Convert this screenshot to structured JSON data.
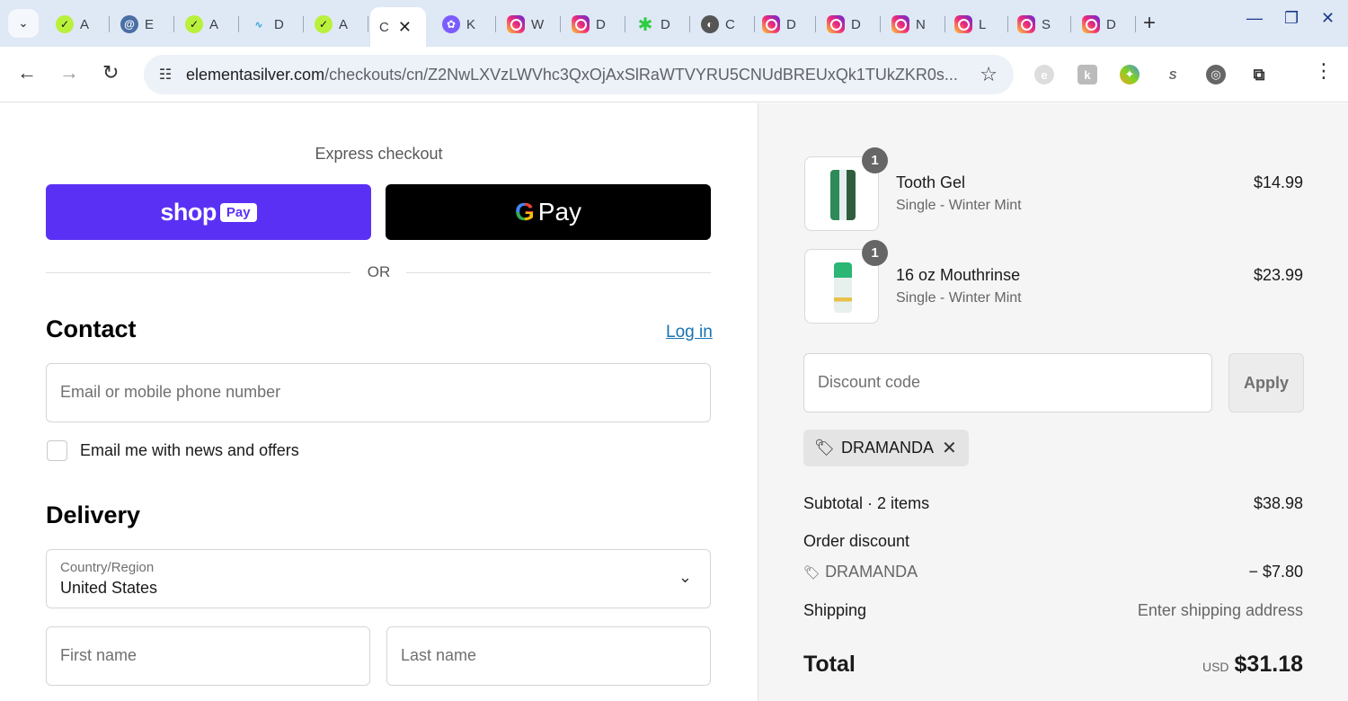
{
  "browser": {
    "tabs": [
      {
        "letter": "A",
        "fav": "green"
      },
      {
        "letter": "E",
        "fav": "spiral"
      },
      {
        "letter": "A",
        "fav": "green"
      },
      {
        "letter": "D",
        "fav": "wave"
      },
      {
        "letter": "A",
        "fav": "green"
      },
      {
        "letter": "C",
        "fav": "none",
        "active": true
      },
      {
        "letter": "K",
        "fav": "purple"
      },
      {
        "letter": "W",
        "fav": "insta"
      },
      {
        "letter": "D",
        "fav": "insta"
      },
      {
        "letter": "D",
        "fav": "lime"
      },
      {
        "letter": "C",
        "fav": "globe"
      },
      {
        "letter": "D",
        "fav": "insta"
      },
      {
        "letter": "D",
        "fav": "insta"
      },
      {
        "letter": "N",
        "fav": "insta"
      },
      {
        "letter": "L",
        "fav": "insta"
      },
      {
        "letter": "S",
        "fav": "insta"
      },
      {
        "letter": "D",
        "fav": "insta"
      }
    ],
    "url_host": "elementasilver.com",
    "url_path": "/checkouts/cn/Z2NwLXVzLWVhc3QxOjAxSlRaWTVYRU5CNUdBREUxQk1TUkZKR0s..."
  },
  "express": {
    "title": "Express checkout",
    "shop_word": "shop",
    "shop_pay": "Pay",
    "gpay_g": "G",
    "gpay_label": "Pay",
    "or": "OR"
  },
  "contact": {
    "heading": "Contact",
    "login": "Log in",
    "email_placeholder": "Email or mobile phone number",
    "news_label": "Email me with news and offers"
  },
  "delivery": {
    "heading": "Delivery",
    "country_label": "Country/Region",
    "country_value": "United States",
    "first_name": "First name",
    "last_name": "Last name"
  },
  "summary": {
    "items": [
      {
        "name": "Tooth Gel",
        "variant": "Single - Winter Mint",
        "price": "$14.99",
        "qty": "1"
      },
      {
        "name": "16 oz Mouthrinse",
        "variant": "Single - Winter Mint",
        "price": "$23.99",
        "qty": "1"
      }
    ],
    "discount_placeholder": "Discount code",
    "apply": "Apply",
    "applied_code": "DRAMANDA",
    "subtotal_label": "Subtotal · 2 items",
    "subtotal_value": "$38.98",
    "order_discount_label": "Order discount",
    "discount_code": "DRAMANDA",
    "discount_value": "− $7.80",
    "shipping_label": "Shipping",
    "shipping_value": "Enter shipping address",
    "total_label": "Total",
    "currency": "USD",
    "total_value": "$31.18"
  },
  "colors": {
    "shop_pay": "#5a31f4",
    "link": "#1773b0"
  }
}
